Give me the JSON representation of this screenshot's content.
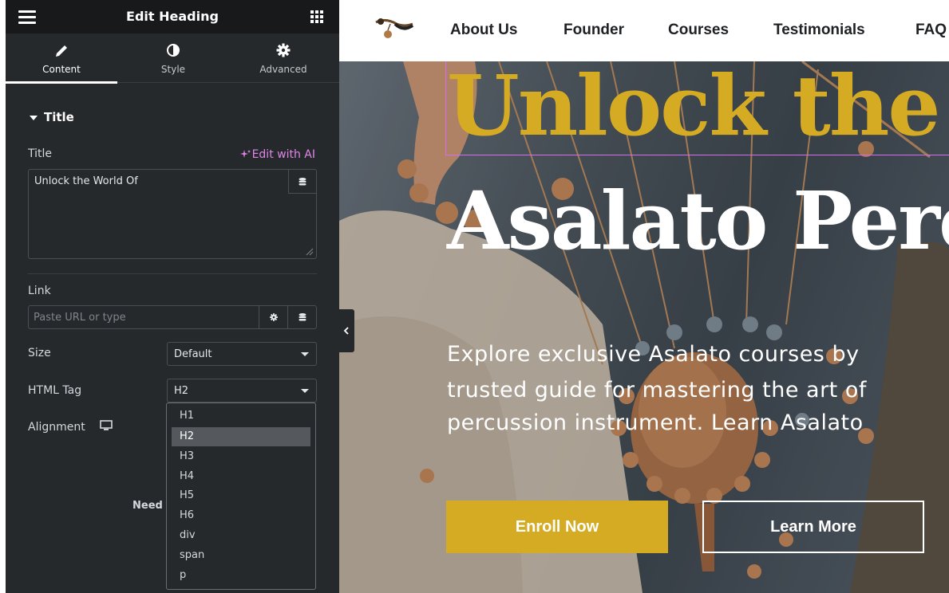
{
  "panel": {
    "title": "Edit Heading",
    "tabs": [
      {
        "label": "Content",
        "icon": "pencil-icon",
        "active": true
      },
      {
        "label": "Style",
        "icon": "contrast-icon",
        "active": false
      },
      {
        "label": "Advanced",
        "icon": "gear-icon",
        "active": false
      }
    ],
    "section_title": "Title",
    "title_label": "Title",
    "edit_ai": "Edit with AI",
    "title_value": "Unlock the World Of",
    "link_label": "Link",
    "link_placeholder": "Paste URL or type",
    "size_label": "Size",
    "size_value": "Default",
    "html_tag_label": "HTML Tag",
    "html_tag_value": "H2",
    "alignment_label": "Alignment",
    "need_text": "Need",
    "html_tag_options": [
      "H1",
      "H2",
      "H3",
      "H4",
      "H5",
      "H6",
      "div",
      "span",
      "p"
    ],
    "html_tag_selected_index": 1
  },
  "site": {
    "nav": [
      "About Us",
      "Founder",
      "Courses",
      "Testimonials",
      "FAQ"
    ],
    "heading_line1": "Unlock the World Of",
    "heading_line2": "Asalato Percussion",
    "paragraph": [
      "Explore exclusive Asalato courses by",
      "trusted guide for mastering the art of",
      "percussion instrument. Learn Asalato"
    ],
    "enroll_button": "Enroll Now",
    "learn_button": "Learn More"
  },
  "colors": {
    "accent_gold": "#d6ab24",
    "panel_bg": "#26292c",
    "panel_header_bg": "#18191b",
    "ai_link": "#e085e8",
    "selection_outline": "#d66cf0"
  }
}
